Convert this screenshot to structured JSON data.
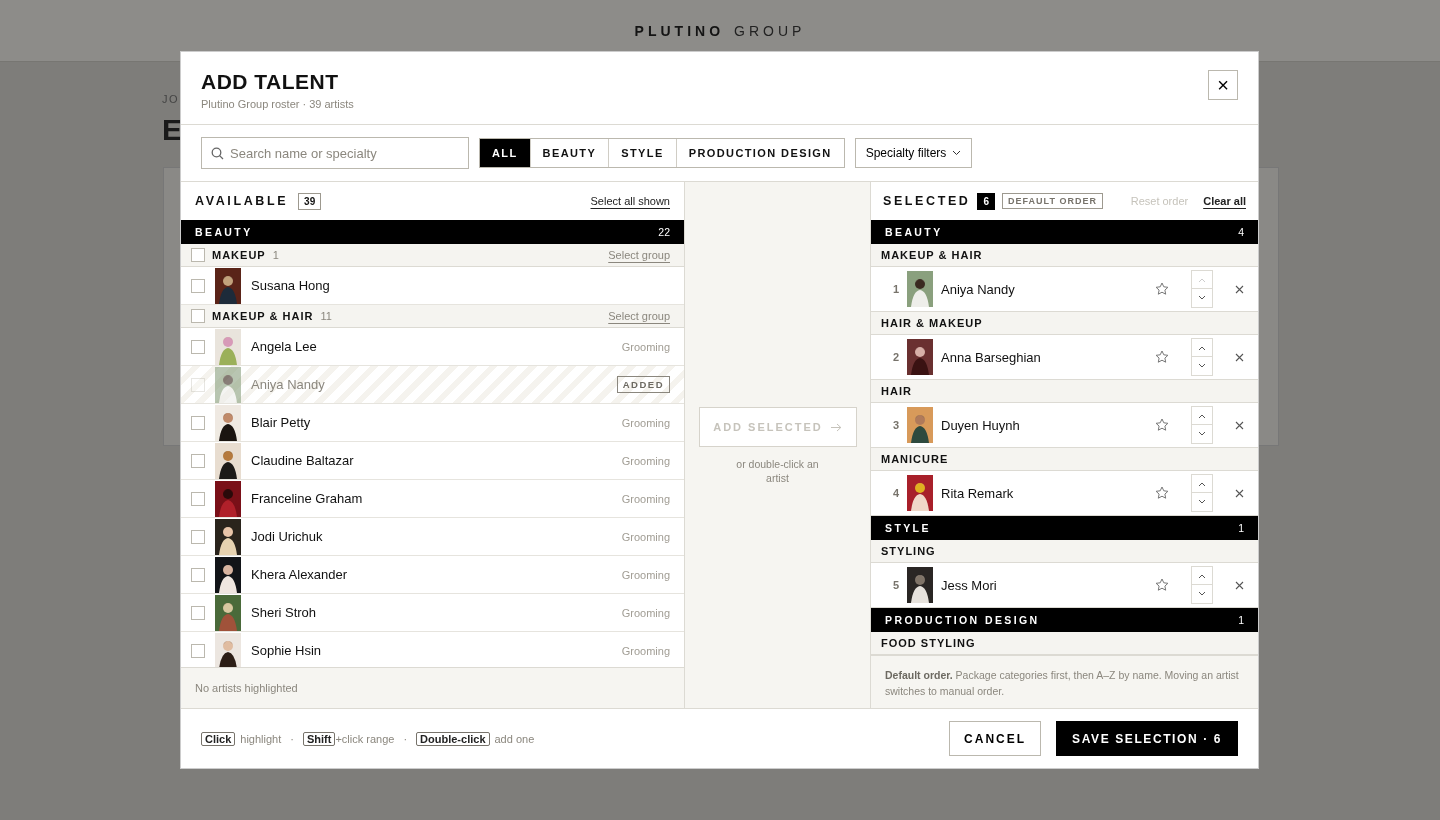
{
  "background": {
    "brand": "PLUTINO",
    "brand_suffix": "GROUP",
    "eyebrow": "JO",
    "title": "E"
  },
  "dialog": {
    "title": "ADD TALENT",
    "subtitle": "Plutino Group roster · 39 artists",
    "close": "×"
  },
  "search": {
    "placeholder": "Search name or specialty"
  },
  "tabs": [
    {
      "label": "ALL",
      "selected": true
    },
    {
      "label": "BEAUTY",
      "selected": false
    },
    {
      "label": "STYLE",
      "selected": false
    },
    {
      "label": "PRODUCTION DESIGN",
      "selected": false
    }
  ],
  "filter_dropdown": {
    "label": "Specialty filters"
  },
  "available": {
    "title": "AVAILABLE",
    "count": "39",
    "select_all": "Select all shown",
    "status": "No artists highlighted",
    "categories": [
      {
        "name": "BEAUTY",
        "count": "22",
        "groups": [
          {
            "name": "MAKEUP",
            "count": "1",
            "checked": false,
            "action": "Select group",
            "artists": [
              {
                "name": "Susana Hong",
                "checked": false,
                "added": false
              }
            ]
          },
          {
            "name": "MAKEUP & HAIR",
            "count": "11",
            "checked": false,
            "action": "Select group",
            "artists": [
              {
                "name": "Angela Lee",
                "specialty": "Grooming",
                "checked": false,
                "added": false
              },
              {
                "name": "Aniya Nandy",
                "badge": "ADDED",
                "checked": false,
                "added": true
              },
              {
                "name": "Blair Petty",
                "specialty": "Grooming",
                "checked": false,
                "added": false
              },
              {
                "name": "Claudine Baltazar",
                "specialty": "Grooming",
                "checked": false,
                "added": false
              },
              {
                "name": "Franceline Graham",
                "specialty": "Grooming",
                "checked": false,
                "added": false
              },
              {
                "name": "Jodi Urichuk",
                "specialty": "Grooming",
                "checked": false,
                "added": false
              },
              {
                "name": "Khera Alexander",
                "specialty": "Grooming",
                "checked": false,
                "added": false
              },
              {
                "name": "Sheri Stroh",
                "specialty": "Grooming",
                "checked": false,
                "added": false
              },
              {
                "name": "Sophie Hsin",
                "specialty": "Grooming",
                "checked": false,
                "added": false
              }
            ]
          }
        ]
      }
    ]
  },
  "transfer": {
    "button": "ADD SELECTED",
    "disabled": true,
    "hint": "or double-click an artist"
  },
  "selected": {
    "title": "SELECTED",
    "count": "6",
    "order_badge": "DEFAULT ORDER",
    "reset": "Reset order",
    "reset_disabled": true,
    "clear": "Clear all",
    "note_bold": "Default order.",
    "note": "Package categories first, then A–Z by name. Moving an artist switches to manual order.",
    "categories": [
      {
        "name": "BEAUTY",
        "count": "4",
        "groups": [
          {
            "name": "MAKEUP & HAIR",
            "artists": [
              {
                "number": "1",
                "name": "Aniya Nandy",
                "starred": false,
                "can_move_up": false
              }
            ]
          },
          {
            "name": "HAIR & MAKEUP",
            "artists": [
              {
                "number": "2",
                "name": "Anna Barseghian",
                "starred": false,
                "can_move_up": true
              }
            ]
          },
          {
            "name": "HAIR",
            "artists": [
              {
                "number": "3",
                "name": "Duyen Huynh",
                "starred": false,
                "can_move_up": true
              }
            ]
          },
          {
            "name": "MANICURE",
            "artists": [
              {
                "number": "4",
                "name": "Rita Remark",
                "starred": false,
                "can_move_up": true
              }
            ]
          }
        ]
      },
      {
        "name": "STYLE",
        "count": "1",
        "groups": [
          {
            "name": "STYLING",
            "artists": [
              {
                "number": "5",
                "name": "Jess Mori",
                "starred": false,
                "can_move_up": true
              }
            ]
          }
        ]
      },
      {
        "name": "PRODUCTION DESIGN",
        "count": "1",
        "groups": [
          {
            "name": "FOOD STYLING"
          }
        ]
      }
    ]
  },
  "footer": {
    "hints": [
      {
        "kind": "key",
        "text": "Click"
      },
      {
        "kind": "label",
        "text": "highlight"
      },
      {
        "kind": "dot",
        "text": "·"
      },
      {
        "kind": "key",
        "text": "Shift"
      },
      {
        "kind": "suffix",
        "text": "+click range"
      },
      {
        "kind": "dot",
        "text": "·"
      },
      {
        "kind": "key",
        "text": "Double-click"
      },
      {
        "kind": "label",
        "text": "add one"
      }
    ],
    "cancel": "CANCEL",
    "save": "SAVE SELECTION · 6"
  }
}
